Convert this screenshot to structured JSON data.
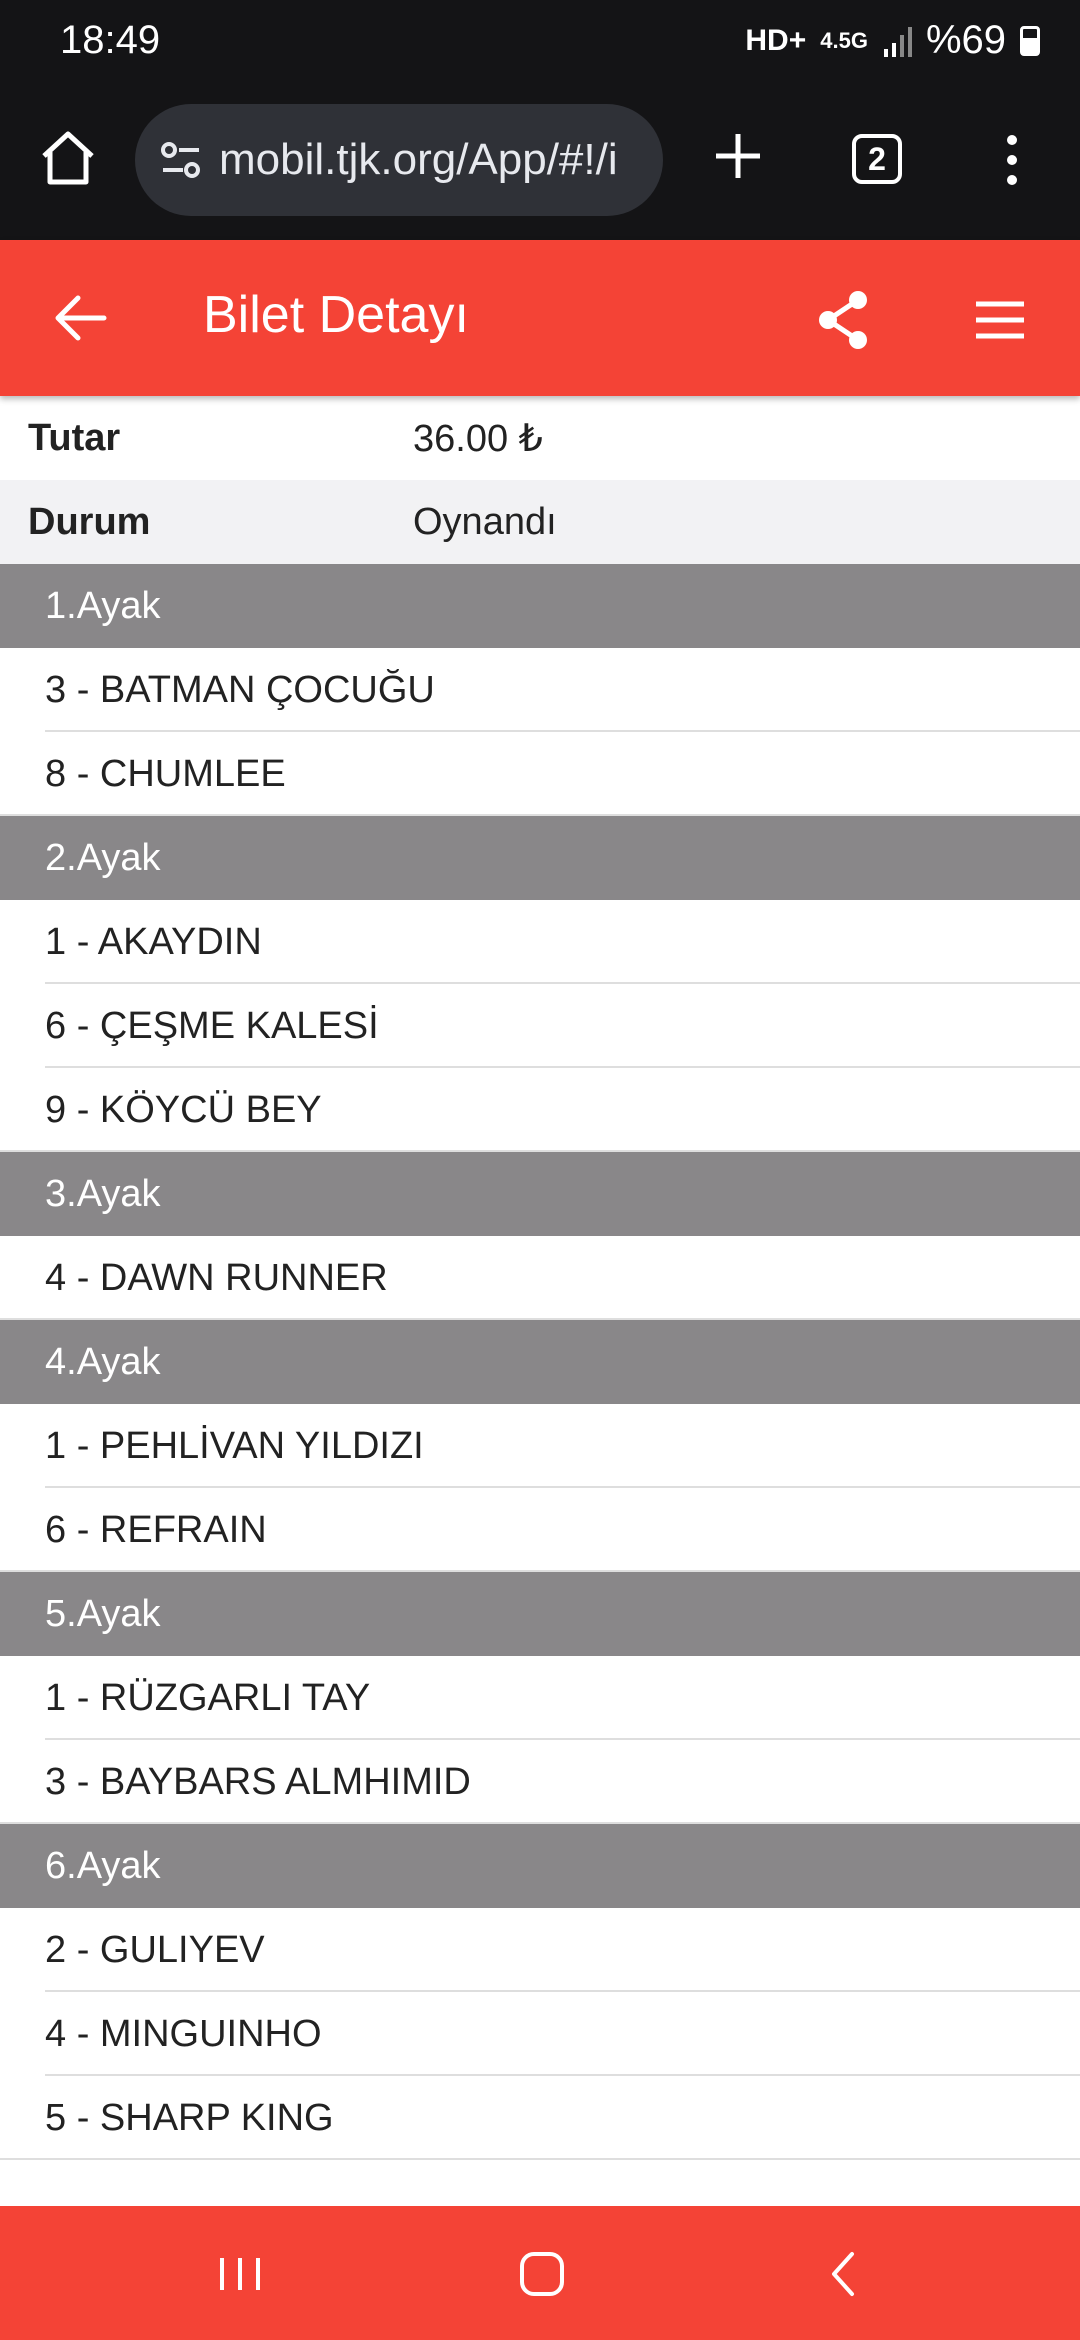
{
  "status_bar": {
    "time": "18:49",
    "network_hd": "HD+",
    "network_type": "4.5G",
    "battery": "%69"
  },
  "browser": {
    "url": "mobil.tjk.org/App/#!/i",
    "tab_count": "2"
  },
  "header": {
    "title": "Bilet Detayı"
  },
  "details": [
    {
      "label": "Tutar",
      "value": "36.00 ₺"
    },
    {
      "label": "Durum",
      "value": "Oynandı"
    }
  ],
  "legs": [
    {
      "name": "1.Ayak",
      "horses": [
        "3 - BATMAN ÇOCUĞU",
        "8 - CHUMLEE"
      ]
    },
    {
      "name": "2.Ayak",
      "horses": [
        "1 - AKAYDIN",
        "6 - ÇEŞME KALESİ",
        "9 - KÖYCÜ BEY"
      ]
    },
    {
      "name": "3.Ayak",
      "horses": [
        "4 - DAWN RUNNER"
      ]
    },
    {
      "name": "4.Ayak",
      "horses": [
        "1 - PEHLİVAN YILDIZI",
        "6 - REFRAIN"
      ]
    },
    {
      "name": "5.Ayak",
      "horses": [
        "1 - RÜZGARLI TAY",
        "3 - BAYBARS ALMHIMID"
      ]
    },
    {
      "name": "6.Ayak",
      "horses": [
        "2 - GULIYEV",
        "4 - MINGUINHO",
        "5 - SHARP KING"
      ]
    }
  ],
  "colors": {
    "accent": "#f44336",
    "leg_header": "#898789",
    "browser_bg": "#141416"
  }
}
